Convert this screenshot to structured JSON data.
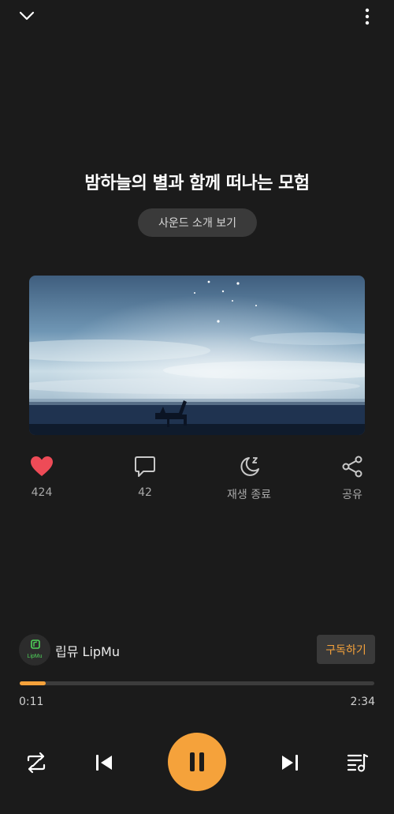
{
  "track": {
    "title": "밤하늘의 별과 함께 떠나는 모험",
    "intro_button": "사운드 소개 보기"
  },
  "actions": {
    "like_count": "424",
    "comment_count": "42",
    "sleep_timer_label": "재생 종료",
    "share_label": "공유"
  },
  "channel": {
    "name": "립뮤 LipMu",
    "avatar_text": "LipMu",
    "subscribe_label": "구독하기"
  },
  "playback": {
    "current_time": "0:11",
    "total_time": "2:34",
    "progress": 0.073,
    "state": "playing"
  },
  "colors": {
    "accent": "#f5a23b",
    "like": "#ee4b57",
    "background": "#1b1b1b"
  },
  "icons": {
    "collapse": "chevron-down-icon",
    "more": "more-vertical-icon",
    "like": "heart-icon",
    "comment": "comment-icon",
    "sleep": "moon-sleep-icon",
    "share": "share-icon",
    "repeat": "repeat-icon",
    "previous": "skip-previous-icon",
    "pause": "pause-icon",
    "next": "skip-next-icon",
    "queue": "playlist-icon"
  }
}
